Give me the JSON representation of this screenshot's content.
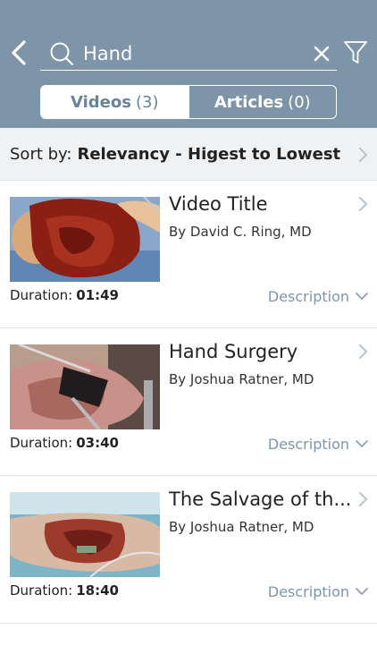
{
  "search": {
    "query": "Hand"
  },
  "tabs": [
    {
      "label": "Videos",
      "count": "(3)"
    },
    {
      "label": "Articles",
      "count": "(0)"
    }
  ],
  "sort": {
    "label": "Sort by:",
    "value": "Relevancy - Higest to Lowest"
  },
  "videos": [
    {
      "title": "Video Title",
      "author": "By David C. Ring, MD",
      "duration_label": "Duration:",
      "duration": "01:49",
      "description_label": "Description"
    },
    {
      "title": "Hand Surgery",
      "author": "By Joshua Ratner, MD",
      "duration_label": "Duration:",
      "duration": "03:40",
      "description_label": "Description"
    },
    {
      "title": "The Salvage of th...",
      "author": "By Joshua Ratner, MD",
      "duration_label": "Duration:",
      "duration": "18:40",
      "description_label": "Description"
    }
  ],
  "colors": {
    "header": "#7e95a9",
    "accent": "#7e95a9",
    "sort_bg": "#f0f1f2"
  },
  "icons": [
    "back-arrow-icon",
    "search-icon",
    "clear-icon",
    "filter-icon",
    "chevron-right-icon",
    "chevron-down-icon"
  ]
}
